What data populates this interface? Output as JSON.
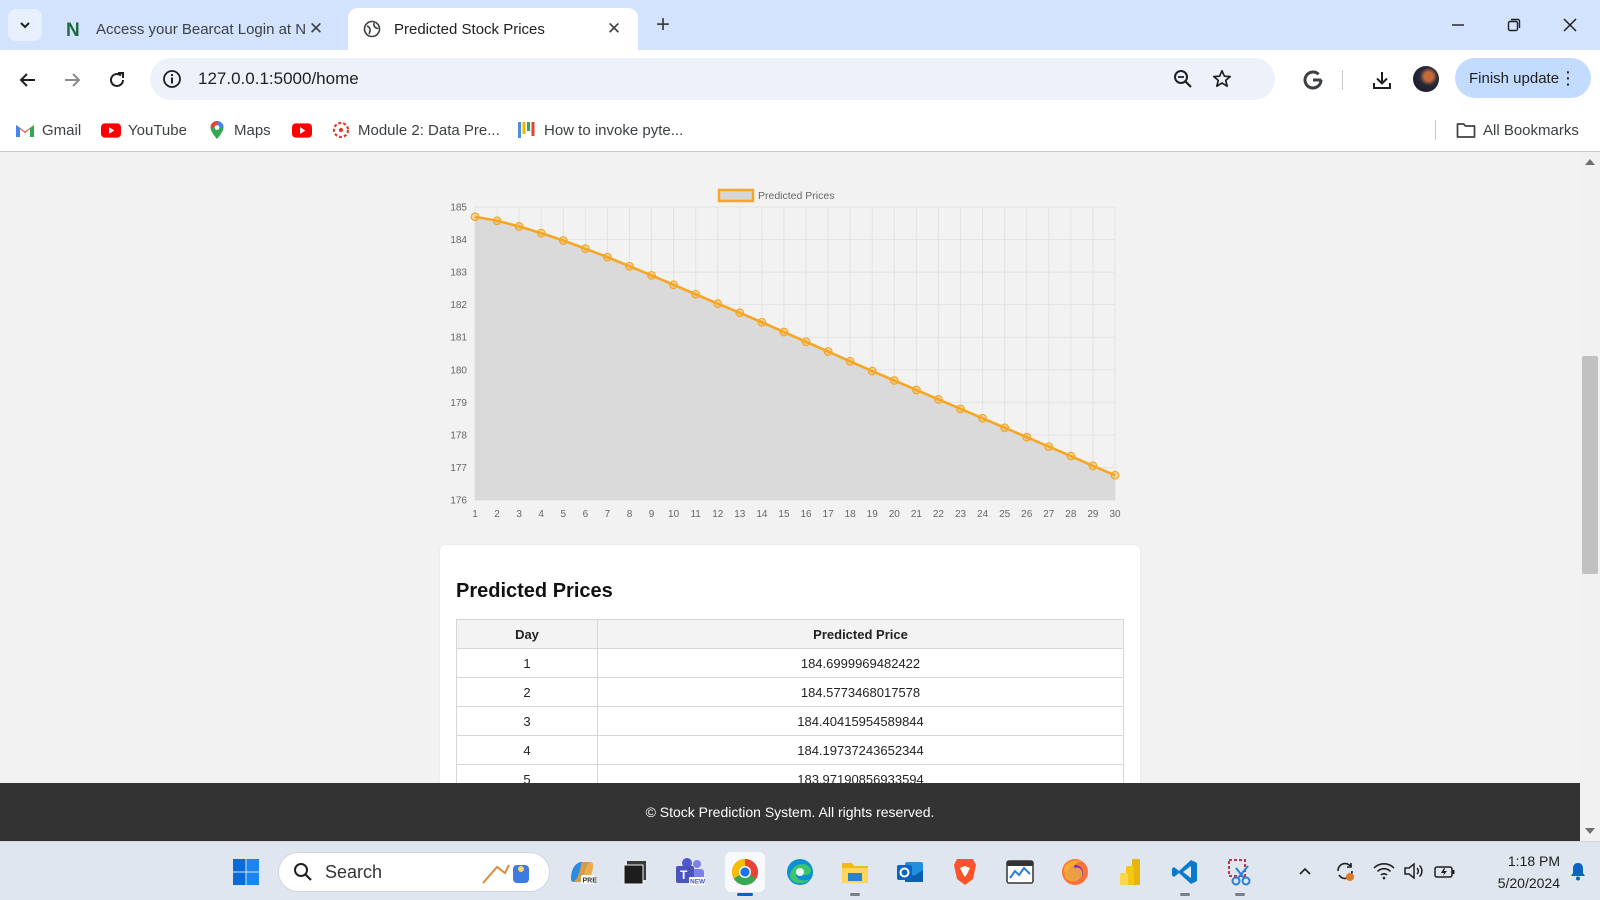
{
  "browser": {
    "tabs": [
      {
        "title": "Access your Bearcat Login at N ",
        "favicon": "n-letter-icon",
        "active": false
      },
      {
        "title": "Predicted Stock Prices",
        "favicon": "globe-icon",
        "active": true
      }
    ],
    "url": "127.0.0.1:5000/home",
    "finish_update_label": "Finish update",
    "bookmarks": [
      {
        "label": "Gmail",
        "icon": "gmail-icon"
      },
      {
        "label": "YouTube",
        "icon": "youtube-icon"
      },
      {
        "label": "Maps",
        "icon": "maps-icon"
      },
      {
        "label": "",
        "icon": "youtube-icon"
      },
      {
        "label": "Module 2: Data Pre...",
        "icon": "canvas-icon"
      },
      {
        "label": "How to invoke pyte...",
        "icon": "bars-icon"
      }
    ],
    "all_bookmarks_label": "All Bookmarks"
  },
  "chart_data": {
    "type": "line",
    "legend": [
      "Predicted Prices"
    ],
    "legend_position": "top",
    "area_fill": true,
    "grid": true,
    "color": "#f5a623",
    "fill_color": "#d6d6d6",
    "x": [
      1,
      2,
      3,
      4,
      5,
      6,
      7,
      8,
      9,
      10,
      11,
      12,
      13,
      14,
      15,
      16,
      17,
      18,
      19,
      20,
      21,
      22,
      23,
      24,
      25,
      26,
      27,
      28,
      29,
      30
    ],
    "series": [
      {
        "name": "Predicted Prices",
        "values": [
          184.6999969482422,
          184.5773468017578,
          184.40415954589844,
          184.19737243652344,
          183.97190856933594,
          183.72,
          183.46,
          183.18,
          182.9,
          182.61,
          182.32,
          182.03,
          181.75,
          181.46,
          181.16,
          180.86,
          180.56,
          180.26,
          179.96,
          179.67,
          179.38,
          179.09,
          178.8,
          178.51,
          178.22,
          177.93,
          177.64,
          177.35,
          177.05,
          176.76
        ]
      }
    ],
    "ylim": [
      176,
      185
    ],
    "yticks": [
      176,
      177,
      178,
      179,
      180,
      181,
      182,
      183,
      184,
      185
    ]
  },
  "table": {
    "title": "Predicted Prices",
    "headers": [
      "Day",
      "Predicted Price"
    ],
    "rows": [
      [
        "1",
        "184.6999969482422"
      ],
      [
        "2",
        "184.5773468017578"
      ],
      [
        "3",
        "184.40415954589844"
      ],
      [
        "4",
        "184.19737243652344"
      ],
      [
        "5",
        "183.97190856933594"
      ]
    ]
  },
  "footer": {
    "text": "© Stock Prediction System. All rights reserved."
  },
  "taskbar": {
    "search_placeholder": "Search",
    "apps": [
      "copilot-icon",
      "terminal-icon",
      "teams-icon",
      "chrome-icon",
      "edge-icon",
      "file-explorer-icon",
      "outlook-icon",
      "brave-icon",
      "task-manager-icon",
      "firefox-icon",
      "power-bi-icon",
      "vscode-icon",
      "snipping-tool-icon"
    ],
    "time": "1:18 PM",
    "date": "5/20/2024"
  }
}
